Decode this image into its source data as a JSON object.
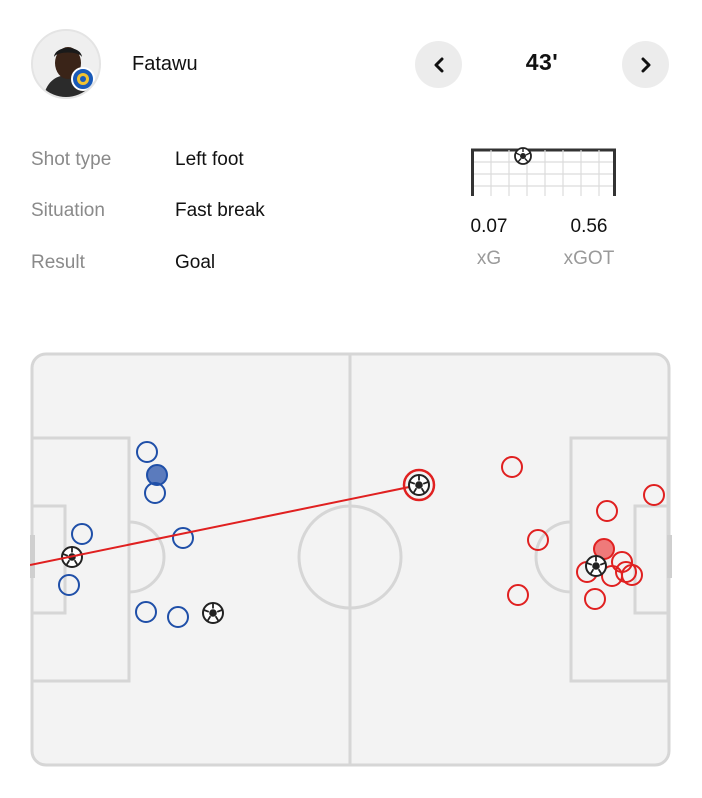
{
  "player": {
    "name": "Fatawu",
    "avatar_icon": "player-portrait-with-club-badge"
  },
  "navigation": {
    "prev_icon": "chevron-left-icon",
    "next_icon": "chevron-right-icon",
    "minute": "43'"
  },
  "shot_details": [
    {
      "label": "Shot type",
      "value": "Left foot"
    },
    {
      "label": "Situation",
      "value": "Fast break"
    },
    {
      "label": "Result",
      "value": "Goal"
    }
  ],
  "stats": {
    "xg_value": "0.07",
    "xg_label": "xG",
    "xgot_value": "0.56",
    "xgot_label": "xGOT"
  },
  "colors": {
    "home": "#1f4fa8",
    "home_fill": "#5b7bbd",
    "away": "#e02020",
    "away_fill": "#ef7a7a",
    "pitch_line": "#d6d6d6",
    "pitch_bg": "#f3f3f3"
  }
}
